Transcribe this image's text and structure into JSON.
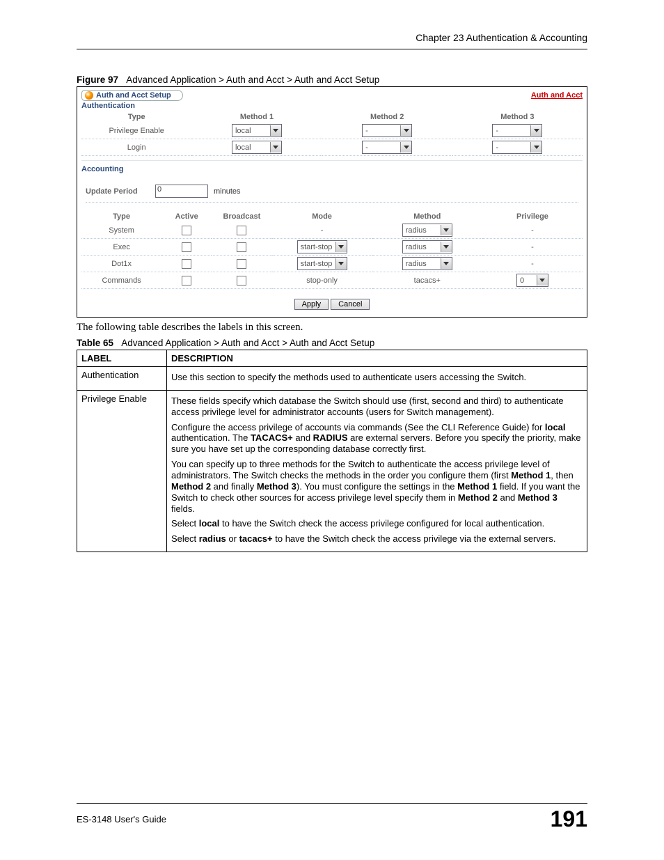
{
  "header": {
    "chapter": "Chapter 23 Authentication & Accounting"
  },
  "figure": {
    "label": "Figure 97",
    "caption": "Advanced Application > Auth and Acct > Auth and Acct Setup"
  },
  "screenshot": {
    "tab_title": "Auth and Acct Setup",
    "link": "Auth and Acct",
    "authentication": {
      "section": "Authentication",
      "headers": {
        "type": "Type",
        "m1": "Method 1",
        "m2": "Method 2",
        "m3": "Method 3"
      },
      "rows": [
        {
          "type": "Privilege Enable",
          "m1": "local",
          "m2": "-",
          "m3": "-"
        },
        {
          "type": "Login",
          "m1": "local",
          "m2": "-",
          "m3": "-"
        }
      ]
    },
    "accounting": {
      "section": "Accounting",
      "update_label": "Update Period",
      "update_value": "0",
      "update_unit": "minutes",
      "headers": {
        "type": "Type",
        "active": "Active",
        "broadcast": "Broadcast",
        "mode": "Mode",
        "method": "Method",
        "privilege": "Privilege"
      },
      "rows": [
        {
          "type": "System",
          "mode": "-",
          "method": "radius",
          "privilege": "-"
        },
        {
          "type": "Exec",
          "mode": "start-stop",
          "method": "radius",
          "privilege": "-"
        },
        {
          "type": "Dot1x",
          "mode": "start-stop",
          "method": "radius",
          "privilege": "-"
        },
        {
          "type": "Commands",
          "mode": "stop-only",
          "method": "tacacs+",
          "privilege": "0"
        }
      ]
    },
    "buttons": {
      "apply": "Apply",
      "cancel": "Cancel"
    }
  },
  "following_text": "The following table describes the labels in this screen.",
  "table_caption": {
    "label": "Table 65",
    "caption": "Advanced Application > Auth and Acct > Auth and Acct Setup"
  },
  "ref_table": {
    "headers": {
      "label": "LABEL",
      "desc": "DESCRIPTION"
    },
    "rows": [
      {
        "label": "Authentication",
        "desc": "Use this section to specify the methods used to authenticate users accessing the Switch."
      },
      {
        "label": "Privilege Enable",
        "p1": "These fields specify which database the Switch should use (first, second and third) to authenticate access privilege level for administrator accounts (users for Switch management).",
        "p2_pre": "Configure the access privilege of accounts via commands (See the CLI Reference Guide) for ",
        "p2_b1": "local",
        "p2_mid1": " authentication. The ",
        "p2_b2": "TACACS+",
        "p2_mid2": " and ",
        "p2_b3": "RADIUS",
        "p2_post": " are external servers. Before you specify the priority, make sure you have set up the corresponding database correctly first.",
        "p3_pre": "You can specify up to three methods for the Switch to authenticate the access privilege level of administrators. The Switch checks the methods in the order you configure them (first ",
        "p3_b1": "Method 1",
        "p3_m1": ", then ",
        "p3_b2": "Method 2",
        "p3_m2": " and finally ",
        "p3_b3": "Method 3",
        "p3_m3": "). You must configure the settings in the ",
        "p3_b4": "Method 1",
        "p3_m4": " field. If you want the Switch to check other sources for access privilege level specify them in ",
        "p3_b5": "Method 2",
        "p3_m5": " and ",
        "p3_b6": "Method 3",
        "p3_post": " fields.",
        "p4_pre": "Select ",
        "p4_b1": "local",
        "p4_post": " to have the Switch check the access privilege configured for local authentication.",
        "p5_pre": "Select ",
        "p5_b1": "radius",
        "p5_m1": " or ",
        "p5_b2": "tacacs+",
        "p5_post": " to have the Switch check the access privilege via the external servers."
      }
    ]
  },
  "footer": {
    "guide": "ES-3148 User's Guide",
    "page": "191"
  }
}
